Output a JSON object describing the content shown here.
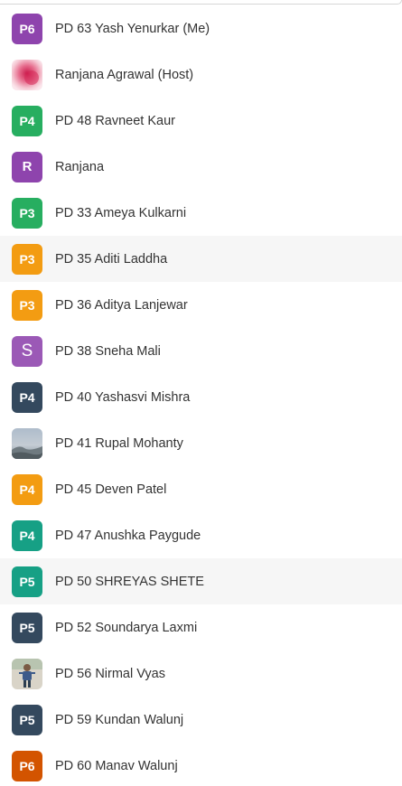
{
  "participants": [
    {
      "name": "PD 63 Yash Yenurkar (Me)",
      "badge": "P6",
      "color": "#8e44ad"
    },
    {
      "name": "Ranjana Agrawal (Host)",
      "badge": "",
      "avatar": "photo-pink"
    },
    {
      "name": "PD 48 Ravneet Kaur",
      "badge": "P4",
      "color": "#27ae60"
    },
    {
      "name": "Ranjana",
      "badge": "R",
      "color": "#8e44ad"
    },
    {
      "name": "PD 33 Ameya Kulkarni",
      "badge": "P3",
      "color": "#27ae60"
    },
    {
      "name": "PD 35 Aditi Laddha",
      "badge": "P3",
      "color": "#f39c12"
    },
    {
      "name": "PD 36 Aditya Lanjewar",
      "badge": "P3",
      "color": "#f39c12"
    },
    {
      "name": "PD 38 Sneha Mali",
      "badge": "S",
      "color": "#9b59b6"
    },
    {
      "name": "PD 40 Yashasvi Mishra",
      "badge": "P4",
      "color": "#34495e"
    },
    {
      "name": "PD 41 Rupal Mohanty",
      "badge": "",
      "avatar": "photo-sky"
    },
    {
      "name": "PD 45 Deven Patel",
      "badge": "P4",
      "color": "#f39c12"
    },
    {
      "name": "PD 47 Anushka Paygude",
      "badge": "P4",
      "color": "#16a085"
    },
    {
      "name": "PD 50 SHREYAS SHETE",
      "badge": "P5",
      "color": "#16a085"
    },
    {
      "name": "PD 52 Soundarya Laxmi",
      "badge": "P5",
      "color": "#34495e"
    },
    {
      "name": "PD 56 Nirmal Vyas",
      "badge": "",
      "avatar": "photo-person"
    },
    {
      "name": "PD 59 Kundan Walunj",
      "badge": "P5",
      "color": "#34495e"
    },
    {
      "name": "PD 60 Manav Walunj",
      "badge": "P6",
      "color": "#d35400"
    }
  ]
}
